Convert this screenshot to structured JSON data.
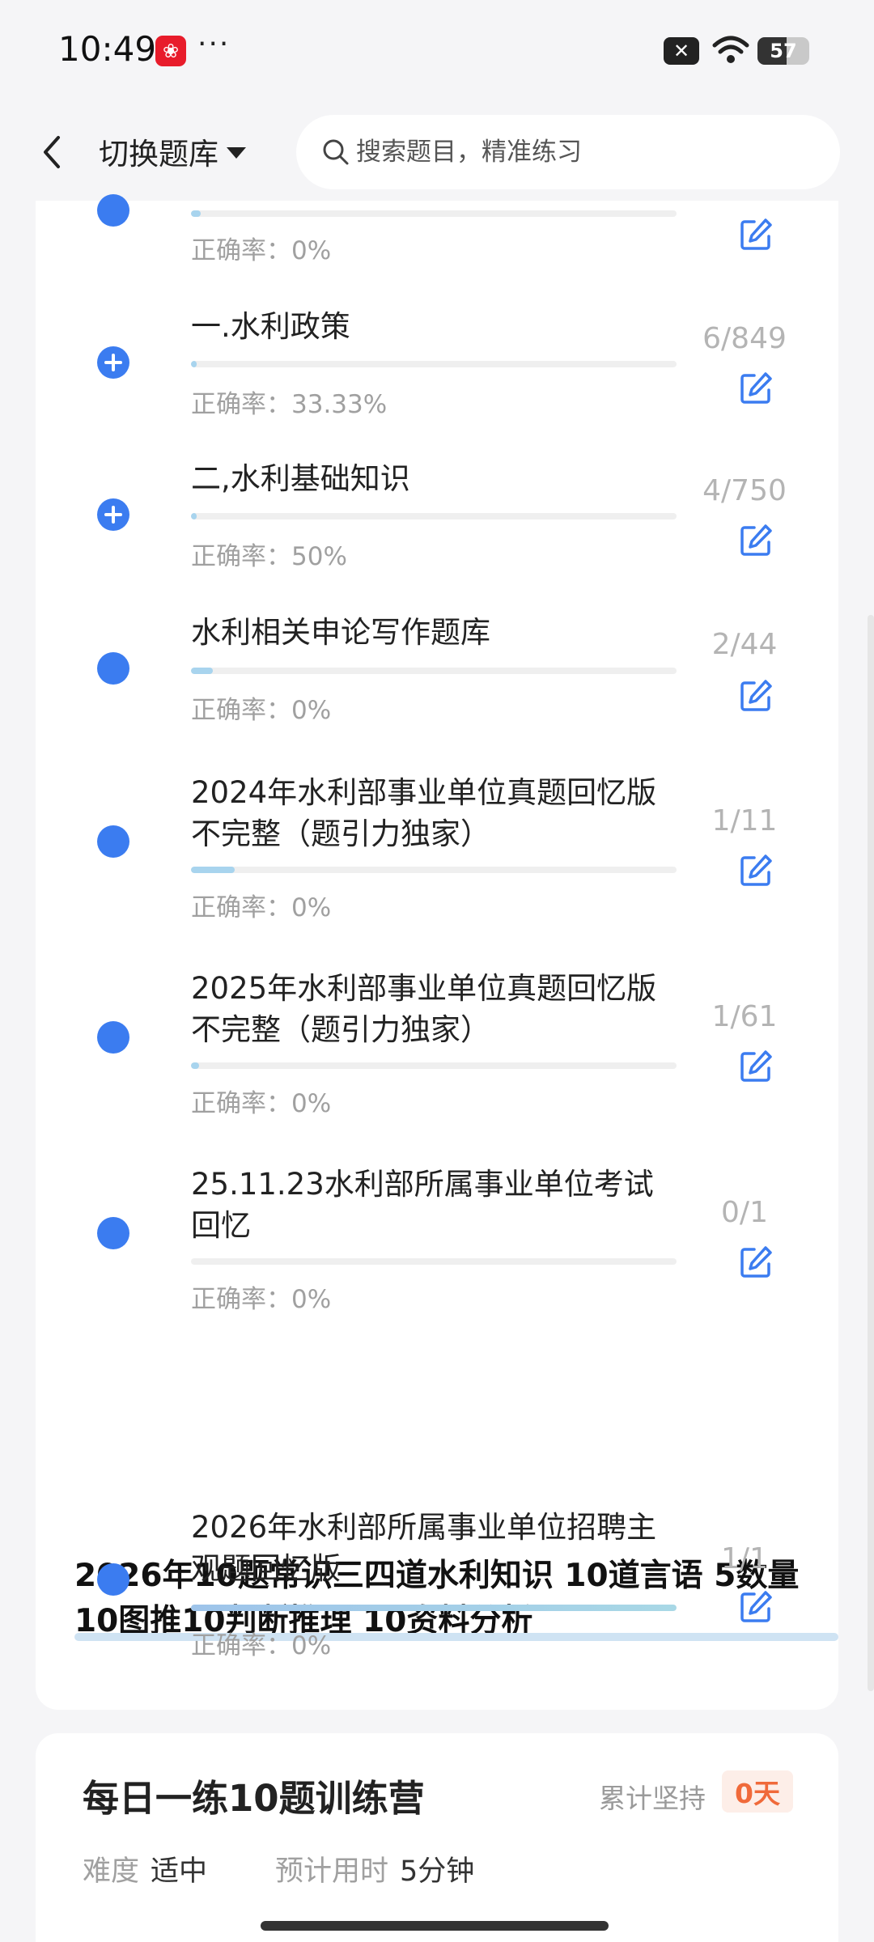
{
  "status": {
    "time": "10:49",
    "dots": "···",
    "battery": 57
  },
  "header": {
    "switch_label": "切换题库",
    "search_placeholder": "搜索题目，精准练习"
  },
  "items": [
    {
      "title": "",
      "accuracy": "正确率：0%",
      "count": "",
      "progress": 0.02,
      "expandable": false
    },
    {
      "title": "一.水利政策",
      "accuracy": "正确率：33.33%",
      "count": "6/849",
      "progress": 0.007,
      "expandable": true
    },
    {
      "title": "二,水利基础知识",
      "accuracy": "正确率：50%",
      "count": "4/750",
      "progress": 0.005,
      "expandable": true
    },
    {
      "title": "水利相关申论写作题库",
      "accuracy": "正确率：0%",
      "count": "2/44",
      "progress": 0.045,
      "expandable": false
    },
    {
      "title": "2024年水利部事业单位真题回忆版不完整（题引力独家）",
      "accuracy": "正确率：0%",
      "count": "1/11",
      "progress": 0.09,
      "expandable": false
    },
    {
      "title": "2025年水利部事业单位真题回忆版不完整（题引力独家）",
      "accuracy": "正确率：0%",
      "count": "1/61",
      "progress": 0.016,
      "expandable": false
    },
    {
      "title": "25.11.23水利部所属事业单位考试回忆",
      "accuracy": "正确率：0%",
      "count": "0/1",
      "progress": 0,
      "expandable": false
    },
    {
      "title": "2026年水利部所属事业单位招聘主观题回忆版",
      "accuracy": "正确率：0%",
      "count": "1/1",
      "progress": 1.0,
      "expandable": false
    }
  ],
  "section_heading": "2026年10题常识三四道水利知识 10道言语 5数量 10图推10判断推理 10资料分析",
  "training": {
    "title": "每日一练10题训练营",
    "streak_label": "累计坚持",
    "streak_value": "0天",
    "difficulty_label": "难度",
    "difficulty_value": "适中",
    "time_label": "预计用时",
    "time_value": "5分钟"
  },
  "colors": {
    "accent": "#3b7cf0",
    "progress": "#a8d4ee",
    "streak": "#f06a3a"
  }
}
